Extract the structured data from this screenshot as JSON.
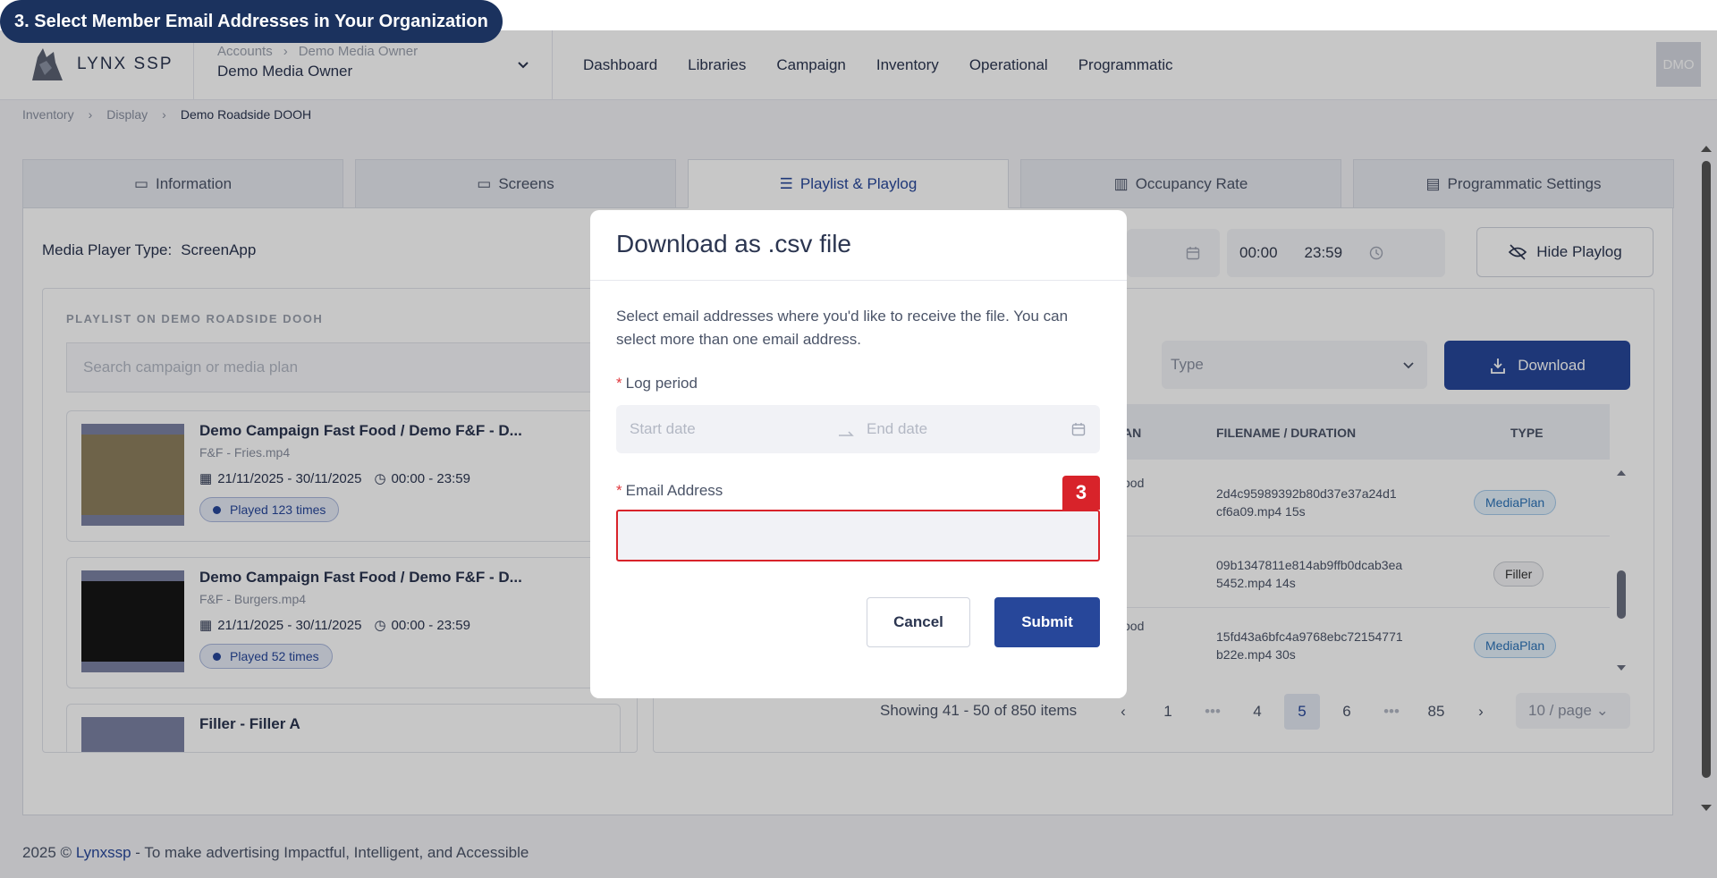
{
  "step_banner": "3. Select Member Email Addresses in Your Organization",
  "header": {
    "logo_text": "LYNX SSP",
    "account_crumbs": [
      "Accounts",
      "Demo Media Owner"
    ],
    "account_name": "Demo Media Owner",
    "nav": [
      "Dashboard",
      "Libraries",
      "Campaign",
      "Inventory",
      "Operational",
      "Programmatic"
    ],
    "avatar": "DMO"
  },
  "breadcrumb": [
    "Inventory",
    "Display",
    "Demo Roadside DOOH"
  ],
  "tabs": [
    {
      "label": "Information",
      "icon": "clipboard-icon"
    },
    {
      "label": "Screens",
      "icon": "monitor-icon"
    },
    {
      "label": "Playlist & Playlog",
      "icon": "list-icon"
    },
    {
      "label": "Occupancy Rate",
      "icon": "chart-icon"
    },
    {
      "label": "Programmatic Settings",
      "icon": "settings-icon"
    }
  ],
  "media_player": {
    "label": "Media Player Type:",
    "value": "ScreenApp"
  },
  "time_range": {
    "start": "00:00",
    "end": "23:59"
  },
  "hide_playlog": "Hide Playlog",
  "playlist": {
    "title": "PLAYLIST ON DEMO ROADSIDE DOOH",
    "search_placeholder": "Search campaign or media plan",
    "cards": [
      {
        "title": "Demo Campaign Fast Food / Demo F&F - D...",
        "file": "F&F - Fries.mp4",
        "dates": "21/11/2025 - 30/11/2025",
        "time": "00:00 - 23:59",
        "played": "Played 123 times"
      },
      {
        "title": "Demo Campaign Fast Food / Demo F&F - D...",
        "file": "F&F - Burgers.mp4",
        "dates": "21/11/2025 - 30/11/2025",
        "time": "00:00 - 23:59",
        "played": "Played 52 times"
      },
      {
        "title": "Filler - Filler A"
      }
    ]
  },
  "playlog": {
    "type_placeholder": "Type",
    "download_label": "Download",
    "columns": [
      "AN",
      "FILENAME / DURATION",
      "TYPE"
    ],
    "rows": [
      {
        "plan": "ood",
        "file_l1": "2d4c95989392b80d37e37a24d1",
        "file_l2": "cf6a09.mp4 15s",
        "type": "MediaPlan"
      },
      {
        "plan": "",
        "file_l1": "09b1347811e814ab9ffb0dcab3ea",
        "file_l2": "5452.mp4 14s",
        "type": "Filler"
      },
      {
        "plan": "ood",
        "file_l1": "15fd43a6bfc4a9768ebc72154771",
        "file_l2": "b22e.mp4 30s",
        "type": "MediaPlan"
      }
    ],
    "pagination": {
      "summary": "Showing 41 - 50 of 850 items",
      "pages": [
        "1",
        "4",
        "5",
        "6",
        "85"
      ],
      "current": "5",
      "ellipsis": "•••",
      "per_page": "10 / page"
    }
  },
  "footer": {
    "year": "2025 ©",
    "brand": "Lynxssp",
    "tagline": "- To make advertising Impactful, Intelligent, and Accessible"
  },
  "modal": {
    "title": "Download as .csv file",
    "description": "Select email addresses where you'd like to receive the file. You can select more than one email address.",
    "log_period_label": "Log period",
    "start_placeholder": "Start date",
    "end_placeholder": "End date",
    "email_label": "Email Address",
    "step_marker": "3",
    "cancel_label": "Cancel",
    "submit_label": "Submit"
  },
  "colors": {
    "primary": "#27479a",
    "banner": "#1b325e",
    "highlight": "#d8232a",
    "required": "#e0393e"
  }
}
